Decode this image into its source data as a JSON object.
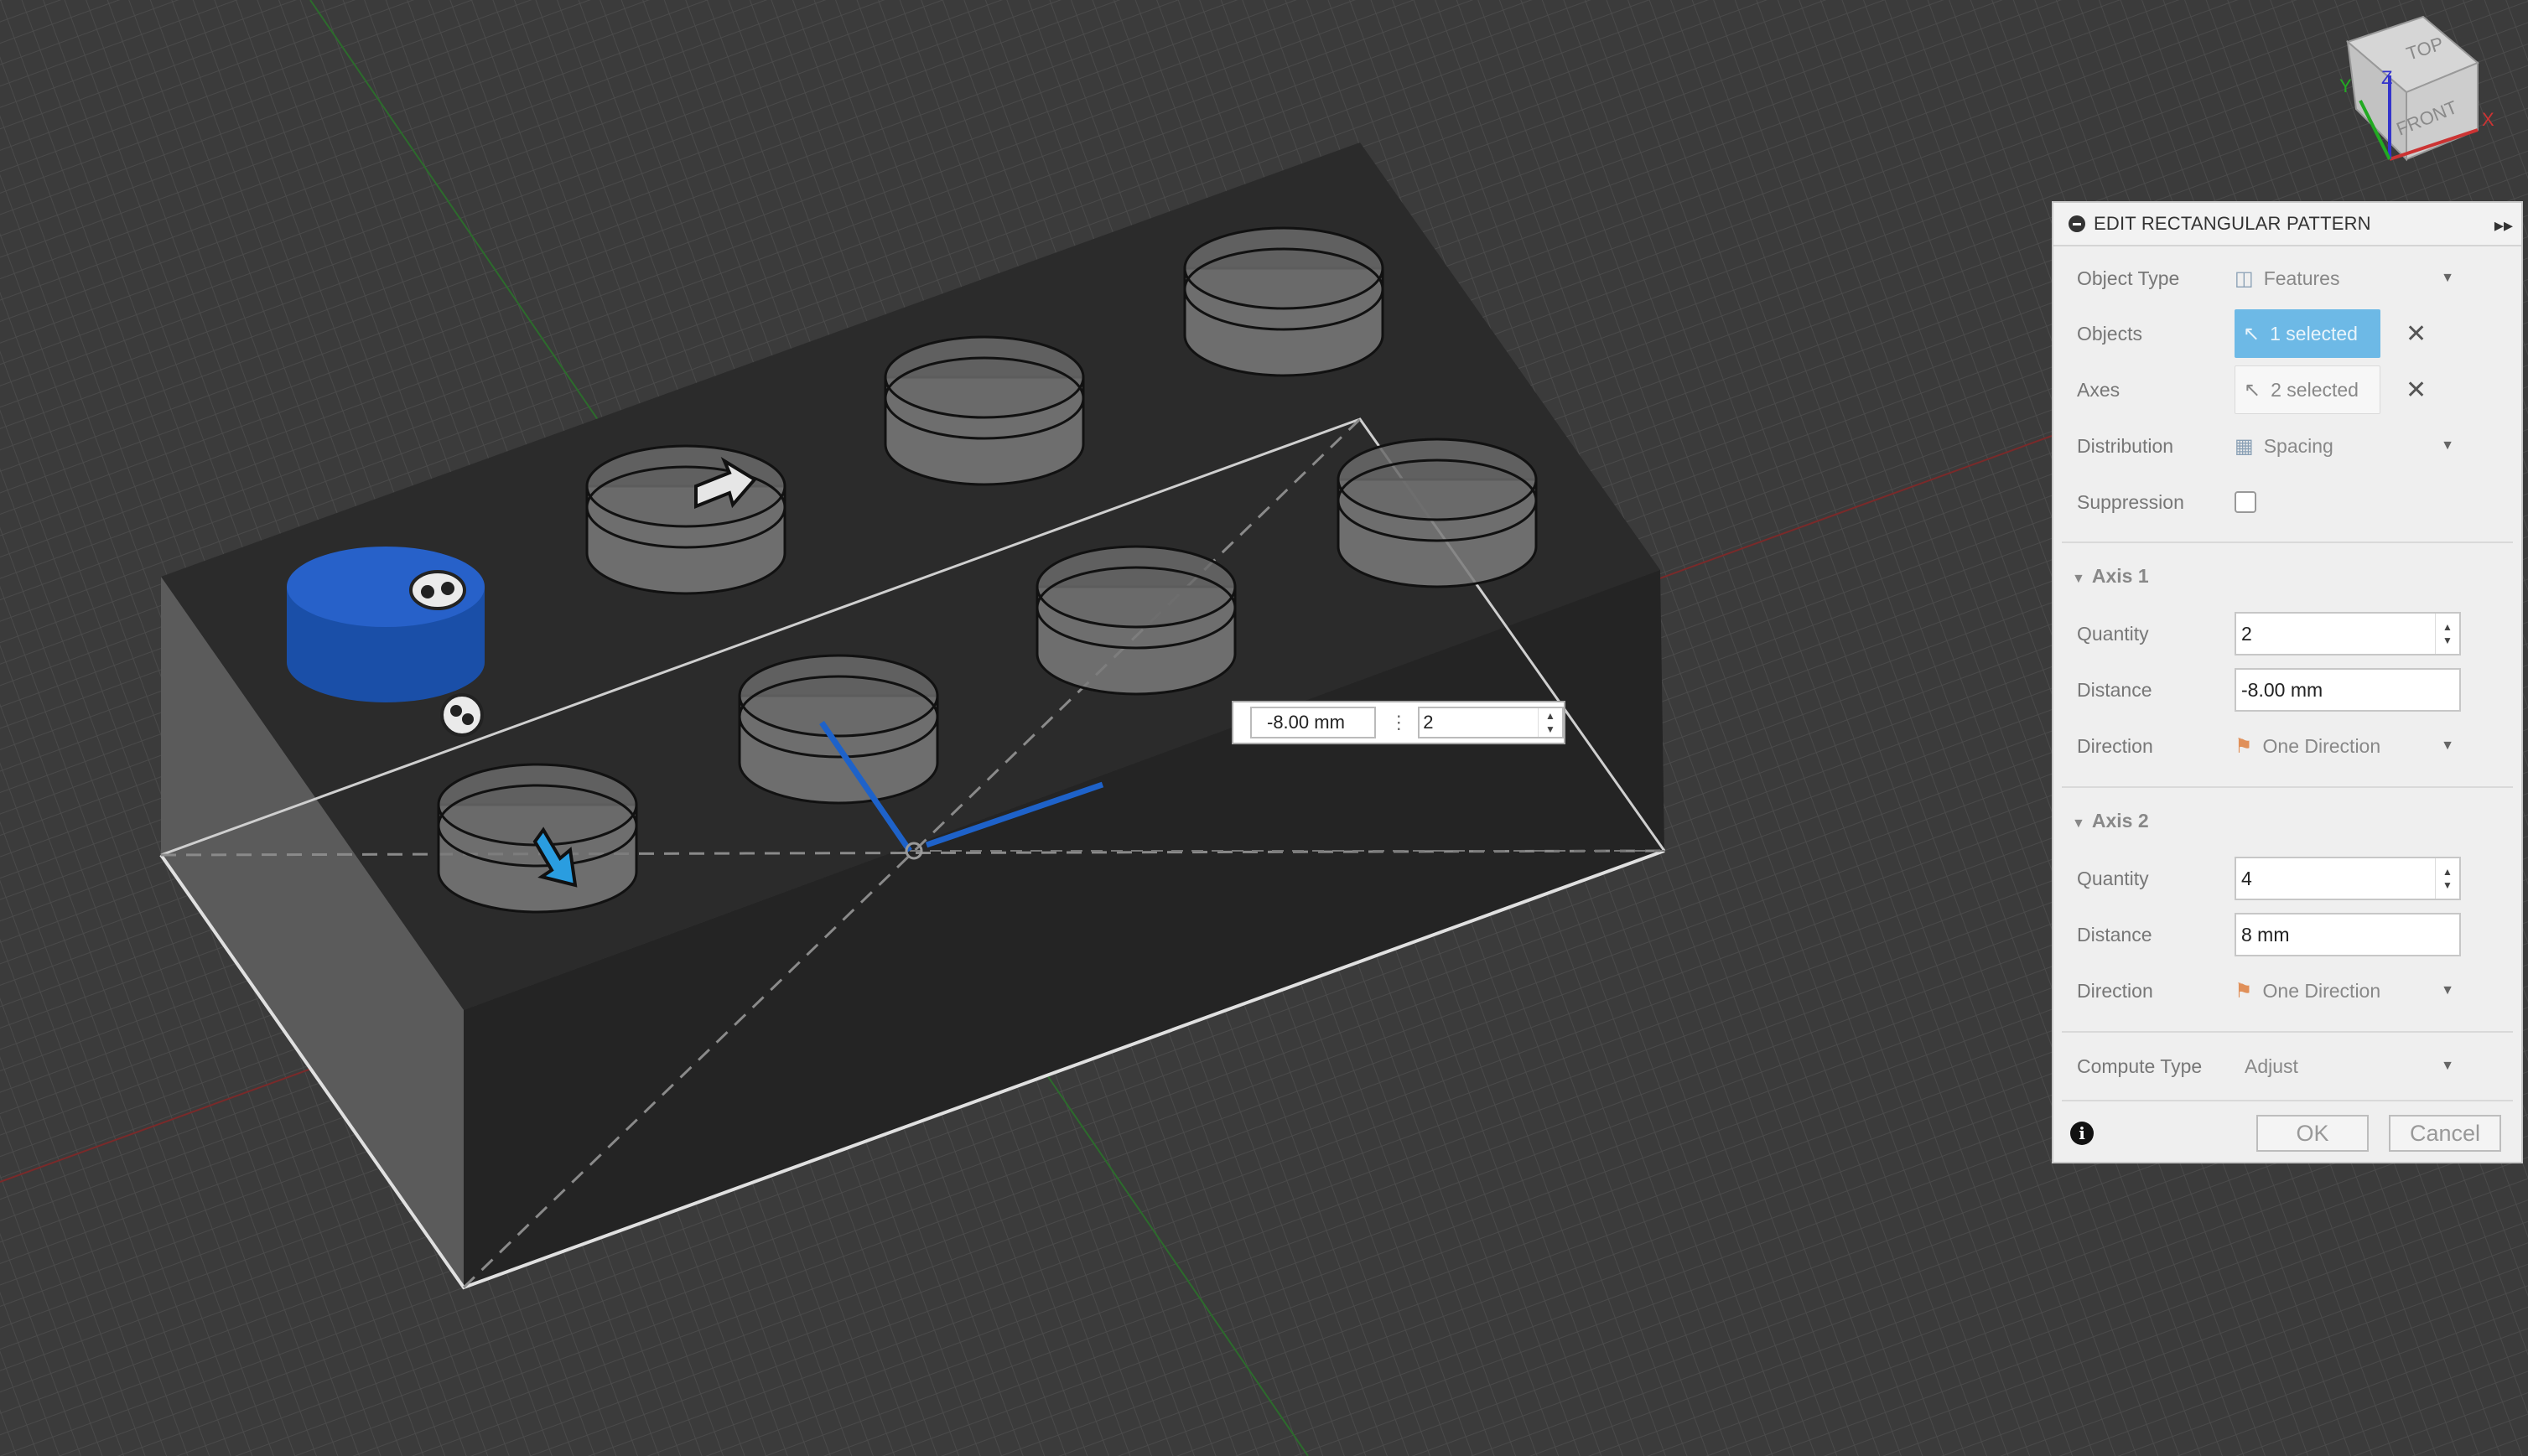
{
  "viewcube": {
    "top": "TOP",
    "front": "FRONT",
    "x": "X",
    "y": "Y",
    "z": "Z"
  },
  "canvas_input": {
    "distance": "-8.00 mm",
    "quantity": "2"
  },
  "panel": {
    "title": "EDIT RECTANGULAR PATTERN",
    "object_type": {
      "label": "Object Type",
      "value": "Features"
    },
    "objects": {
      "label": "Objects",
      "value": "1 selected"
    },
    "axes": {
      "label": "Axes",
      "value": "2 selected"
    },
    "distribution": {
      "label": "Distribution",
      "value": "Spacing"
    },
    "suppression": {
      "label": "Suppression"
    },
    "axis1": {
      "title": "Axis 1",
      "quantity_label": "Quantity",
      "quantity": "2",
      "distance_label": "Distance",
      "distance": "-8.00 mm",
      "direction_label": "Direction",
      "direction": "One Direction"
    },
    "axis2": {
      "title": "Axis 2",
      "quantity_label": "Quantity",
      "quantity": "4",
      "distance_label": "Distance",
      "distance": "8 mm",
      "direction_label": "Direction",
      "direction": "One Direction"
    },
    "compute_type": {
      "label": "Compute Type",
      "value": "Adjust"
    },
    "ok": "OK",
    "cancel": "Cancel"
  },
  "colors": {
    "background": "#3b3b3b",
    "selected_feature": "#1f55b8",
    "accent": "#6db9e6"
  }
}
